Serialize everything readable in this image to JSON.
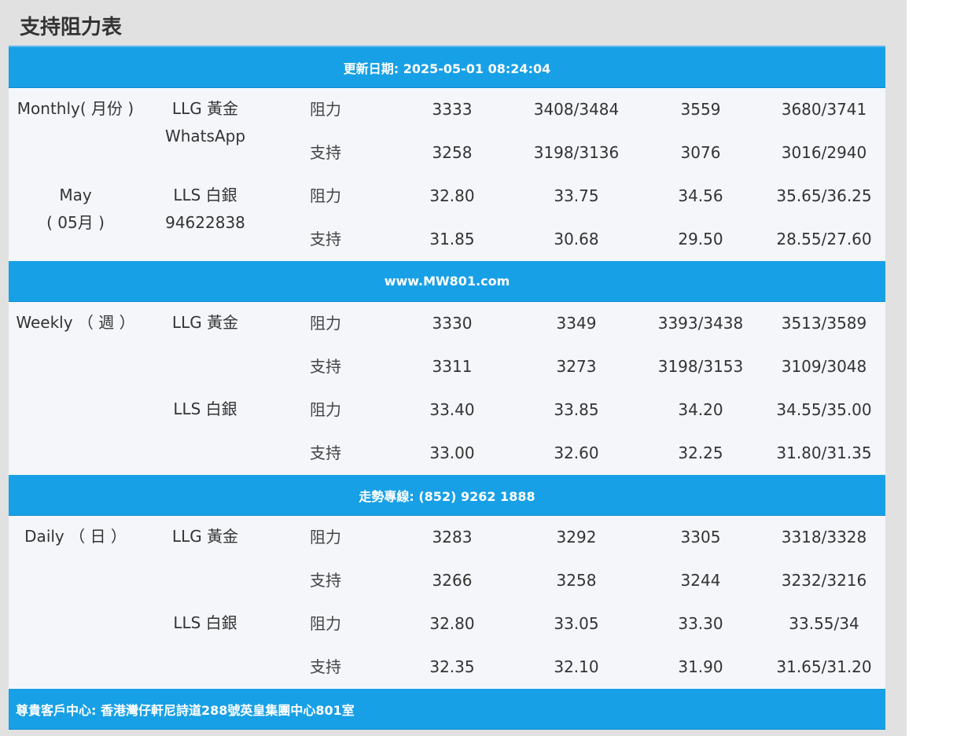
{
  "title": "支持阻力表",
  "bars": {
    "update": "更新日期: 2025-05-01 08:24:04",
    "website": "www.MW801.com",
    "hotline": "走勢專線: (852) 9262 1888",
    "address": "尊貴客戶中心: 香港灣仔軒尼詩道288號英皇集團中心801室"
  },
  "sections": [
    {
      "period": [
        "Monthly( 月份 )",
        "",
        "",
        "May",
        "( 05月 )"
      ],
      "metals": [
        {
          "lines": [
            "LLG 黃金",
            "WhatsApp"
          ]
        },
        {
          "lines": [
            "LLS 白銀",
            "94622838"
          ]
        }
      ],
      "rows": [
        {
          "label": "阻力",
          "values": [
            "3333",
            "3408/3484",
            "3559",
            "3680/3741"
          ]
        },
        {
          "label": "支持",
          "values": [
            "3258",
            "3198/3136",
            "3076",
            "3016/2940"
          ]
        },
        {
          "label": "阻力",
          "values": [
            "32.80",
            "33.75",
            "34.56",
            "35.65/36.25"
          ]
        },
        {
          "label": "支持",
          "values": [
            "31.85",
            "30.68",
            "29.50",
            "28.55/27.60"
          ]
        }
      ]
    },
    {
      "period": [
        "Weekly （ 週 ）"
      ],
      "metals": [
        {
          "lines": [
            "LLG 黃金"
          ]
        },
        {
          "lines": [
            "LLS 白銀"
          ]
        }
      ],
      "rows": [
        {
          "label": "阻力",
          "values": [
            "3330",
            "3349",
            "3393/3438",
            "3513/3589"
          ]
        },
        {
          "label": "支持",
          "values": [
            "3311",
            "3273",
            "3198/3153",
            "3109/3048"
          ]
        },
        {
          "label": "阻力",
          "values": [
            "33.40",
            "33.85",
            "34.20",
            "34.55/35.00"
          ]
        },
        {
          "label": "支持",
          "values": [
            "33.00",
            "32.60",
            "32.25",
            "31.80/31.35"
          ]
        }
      ]
    },
    {
      "period": [
        "Daily （ 日 ）"
      ],
      "metals": [
        {
          "lines": [
            "LLG 黃金"
          ]
        },
        {
          "lines": [
            "LLS 白銀"
          ]
        }
      ],
      "rows": [
        {
          "label": "阻力",
          "values": [
            "3283",
            "3292",
            "3305",
            "3318/3328"
          ]
        },
        {
          "label": "支持",
          "values": [
            "3266",
            "3258",
            "3244",
            "3232/3216"
          ]
        },
        {
          "label": "阻力",
          "values": [
            "32.80",
            "33.05",
            "33.30",
            "33.55/34"
          ]
        },
        {
          "label": "支持",
          "values": [
            "32.35",
            "32.10",
            "31.90",
            "31.65/31.20"
          ]
        }
      ]
    }
  ]
}
